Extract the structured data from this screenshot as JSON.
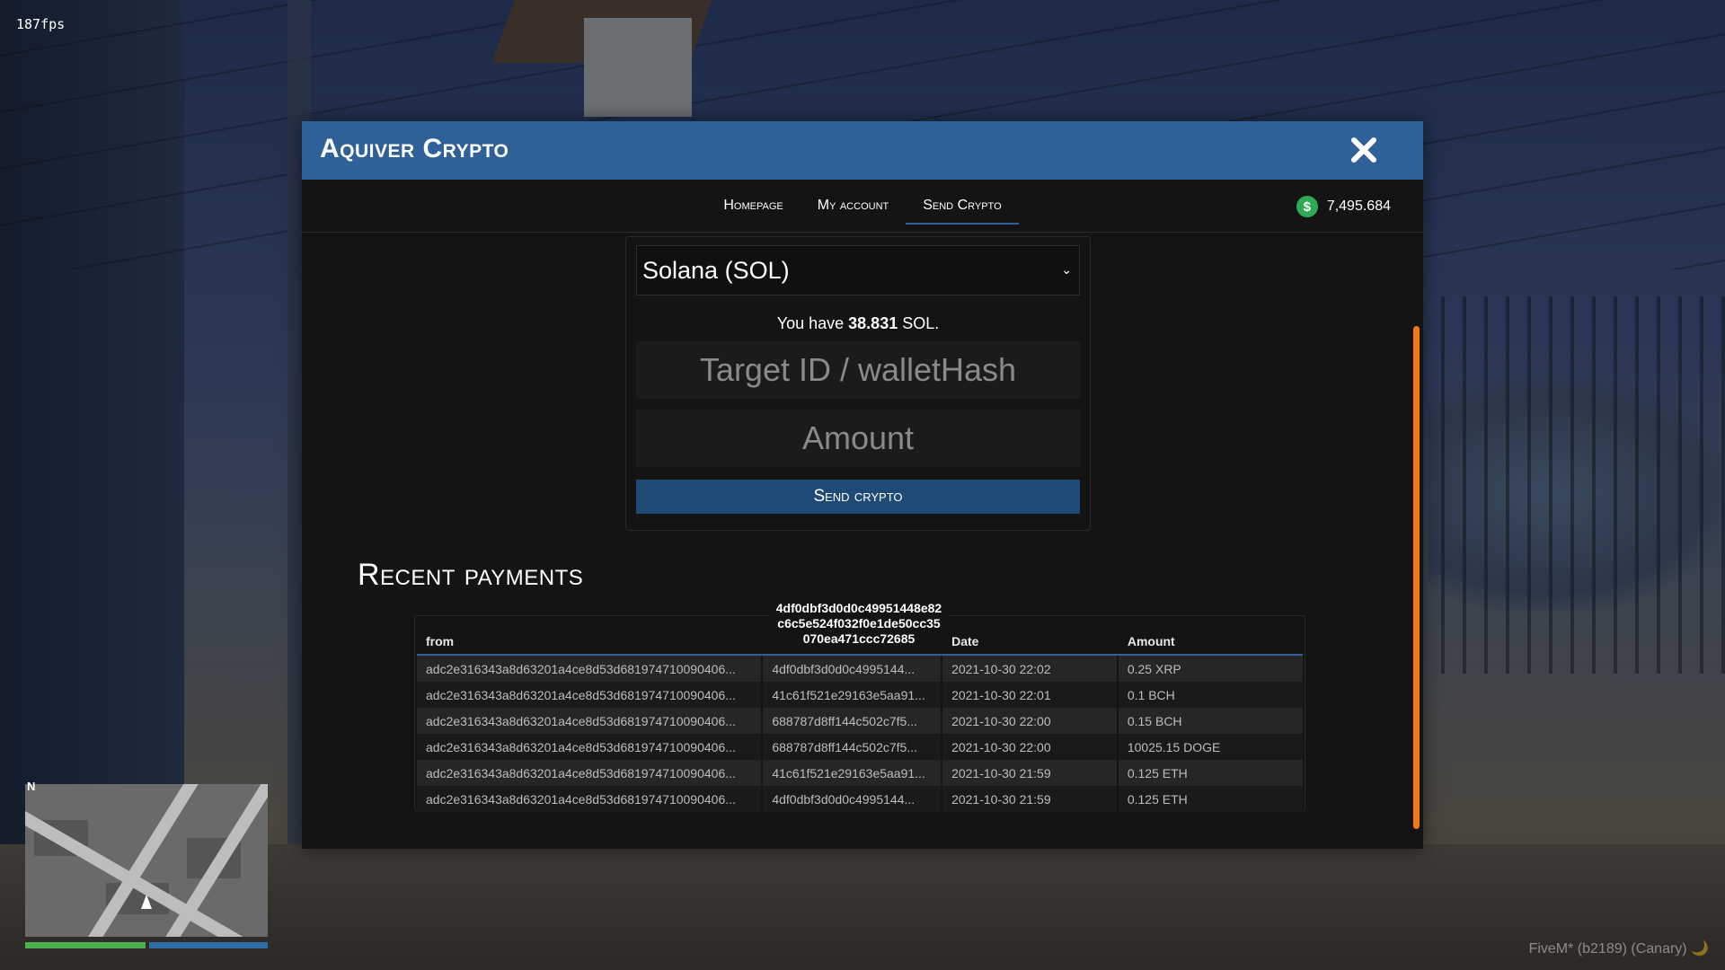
{
  "overlay": {
    "fps": "187fps",
    "watermark": "FiveM* (b2189) (Canary) 🌙",
    "minimap_north": "N"
  },
  "app": {
    "title": "Aquiver Crypto",
    "accent_color": "#2f6098",
    "close_icon": "close-icon"
  },
  "nav": {
    "tabs": [
      {
        "label": "Homepage",
        "active": false
      },
      {
        "label": "My account",
        "active": false
      },
      {
        "label": "Send Crypto",
        "active": true
      }
    ],
    "balance_icon": "dollar-coin-icon",
    "balance": "7,495.684"
  },
  "send_form": {
    "selected_currency": "Solana (SOL)",
    "holding_prefix": "You have ",
    "holding_amount": "38.831",
    "holding_suffix": " SOL.",
    "target_placeholder": "Target ID / walletHash",
    "amount_placeholder": "Amount",
    "submit_label": "Send crypto"
  },
  "recent_payments": {
    "title": "Recent payments",
    "tooltip": "4df0dbf3d0d0c49951448e82c6c5e524f032f0e1de50cc35070ea471ccc72685",
    "columns": [
      "from",
      "",
      "Date",
      "Amount"
    ],
    "rows": [
      {
        "from": "adc2e316343a8d63201a4ce8d53d681974710090406...",
        "to": "4df0dbf3d0d0c4995144...",
        "date": "2021-10-30 22:02",
        "amount": "0.25 XRP"
      },
      {
        "from": "adc2e316343a8d63201a4ce8d53d681974710090406...",
        "to": "41c61f521e29163e5aa91...",
        "date": "2021-10-30 22:01",
        "amount": "0.1 BCH"
      },
      {
        "from": "adc2e316343a8d63201a4ce8d53d681974710090406...",
        "to": "688787d8ff144c502c7f5...",
        "date": "2021-10-30 22:00",
        "amount": "0.15 BCH"
      },
      {
        "from": "adc2e316343a8d63201a4ce8d53d681974710090406...",
        "to": "688787d8ff144c502c7f5...",
        "date": "2021-10-30 22:00",
        "amount": "10025.15 DOGE"
      },
      {
        "from": "adc2e316343a8d63201a4ce8d53d681974710090406...",
        "to": "41c61f521e29163e5aa91...",
        "date": "2021-10-30 21:59",
        "amount": "0.125 ETH"
      },
      {
        "from": "adc2e316343a8d63201a4ce8d53d681974710090406...",
        "to": "4df0dbf3d0d0c4995144...",
        "date": "2021-10-30 21:59",
        "amount": "0.125 ETH"
      }
    ]
  },
  "scrollbar_color": "#f07a14"
}
